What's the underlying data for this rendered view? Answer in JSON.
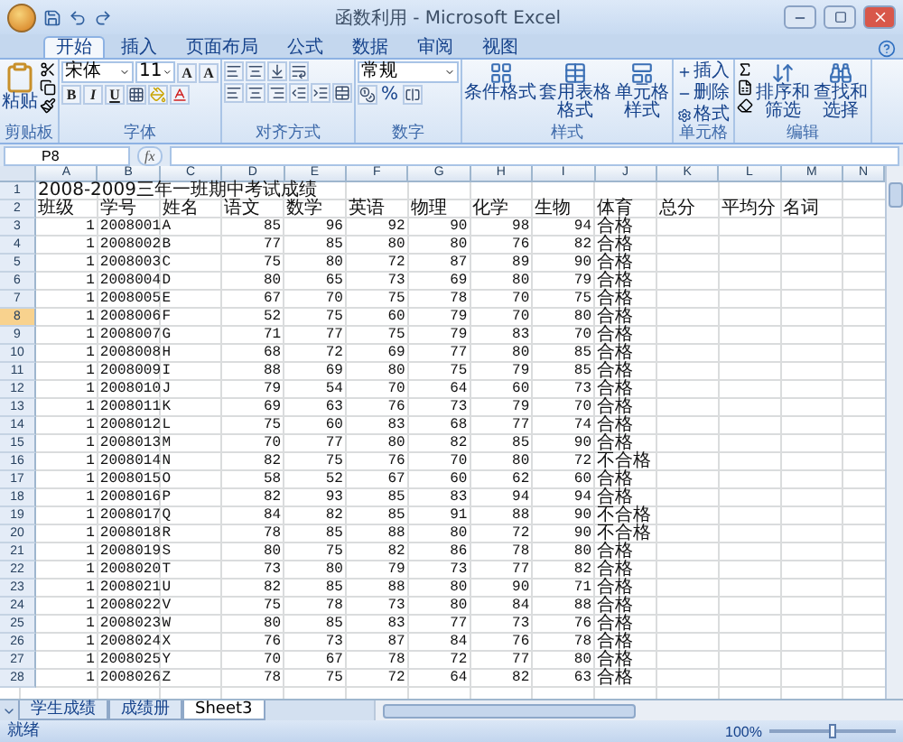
{
  "window": {
    "title": "函数利用 - Microsoft Excel"
  },
  "ribbon_tabs": [
    {
      "label": "开始",
      "selected": true
    },
    {
      "label": "插入",
      "selected": false
    },
    {
      "label": "页面布局",
      "selected": false
    },
    {
      "label": "公式",
      "selected": false
    },
    {
      "label": "数据",
      "selected": false
    },
    {
      "label": "审阅",
      "selected": false
    },
    {
      "label": "视图",
      "selected": false
    }
  ],
  "clipboard": {
    "label": "剪贴板",
    "paste": "粘贴"
  },
  "font": {
    "label": "字体",
    "name": "宋体",
    "size": "11",
    "grow_shrink": [
      "A",
      "A"
    ],
    "styles": [
      "B",
      "I",
      "U"
    ]
  },
  "alignment": {
    "label": "对齐方式"
  },
  "number": {
    "label": "数字",
    "format": "常规",
    "percent": "%"
  },
  "styles": {
    "label": "样式",
    "buttons": [
      "条件格式",
      "套用表格格式",
      "单元格样式"
    ]
  },
  "cells": {
    "label": "单元格",
    "buttons": [
      "插入",
      "删除",
      "格式"
    ]
  },
  "editing": {
    "label": "编辑",
    "buttons": [
      "排序和筛选",
      "查找和选择"
    ]
  },
  "formula_bar": {
    "name_box": "P8",
    "function_label": "fx"
  },
  "columns": [
    "A",
    "B",
    "C",
    "D",
    "E",
    "F",
    "G",
    "H",
    "I",
    "J",
    "K",
    "L",
    "M",
    "N"
  ],
  "rows": [
    {
      "number": "1",
      "kind": "title",
      "selected": false,
      "cells": [
        "2008-2009三年一班期中考试成绩"
      ]
    },
    {
      "number": "2",
      "kind": "header",
      "selected": false,
      "cells": [
        "班级",
        "学号",
        "姓名",
        "语文",
        "数学",
        "英语",
        "物理",
        "化学",
        "生物",
        "体育",
        "总分",
        "平均分",
        "名词"
      ]
    },
    {
      "number": "3",
      "kind": "data",
      "selected": false,
      "cells": [
        "1",
        "2008001",
        "A",
        "85",
        "96",
        "92",
        "90",
        "98",
        "94",
        "合格"
      ]
    },
    {
      "number": "4",
      "kind": "data",
      "selected": false,
      "cells": [
        "1",
        "2008002",
        "B",
        "77",
        "85",
        "80",
        "80",
        "76",
        "82",
        "合格"
      ]
    },
    {
      "number": "5",
      "kind": "data",
      "selected": false,
      "cells": [
        "1",
        "2008003",
        "C",
        "75",
        "80",
        "72",
        "87",
        "89",
        "90",
        "合格"
      ]
    },
    {
      "number": "6",
      "kind": "data",
      "selected": false,
      "cells": [
        "1",
        "2008004",
        "D",
        "80",
        "65",
        "73",
        "69",
        "80",
        "79",
        "合格"
      ]
    },
    {
      "number": "7",
      "kind": "data",
      "selected": false,
      "cells": [
        "1",
        "2008005",
        "E",
        "67",
        "70",
        "75",
        "78",
        "70",
        "75",
        "合格"
      ]
    },
    {
      "number": "8",
      "kind": "data",
      "selected": true,
      "cells": [
        "1",
        "2008006",
        "F",
        "52",
        "75",
        "60",
        "79",
        "70",
        "80",
        "合格"
      ]
    },
    {
      "number": "9",
      "kind": "data",
      "selected": false,
      "cells": [
        "1",
        "2008007",
        "G",
        "71",
        "77",
        "75",
        "79",
        "83",
        "70",
        "合格"
      ]
    },
    {
      "number": "10",
      "kind": "data",
      "selected": false,
      "cells": [
        "1",
        "2008008",
        "H",
        "68",
        "72",
        "69",
        "77",
        "80",
        "85",
        "合格"
      ]
    },
    {
      "number": "11",
      "kind": "data",
      "selected": false,
      "cells": [
        "1",
        "2008009",
        "I",
        "88",
        "69",
        "80",
        "75",
        "79",
        "85",
        "合格"
      ]
    },
    {
      "number": "12",
      "kind": "data",
      "selected": false,
      "cells": [
        "1",
        "2008010",
        "J",
        "79",
        "54",
        "70",
        "64",
        "60",
        "73",
        "合格"
      ]
    },
    {
      "number": "13",
      "kind": "data",
      "selected": false,
      "cells": [
        "1",
        "2008011",
        "K",
        "69",
        "63",
        "76",
        "73",
        "79",
        "70",
        "合格"
      ]
    },
    {
      "number": "14",
      "kind": "data",
      "selected": false,
      "cells": [
        "1",
        "2008012",
        "L",
        "75",
        "60",
        "83",
        "68",
        "77",
        "74",
        "合格"
      ]
    },
    {
      "number": "15",
      "kind": "data",
      "selected": false,
      "cells": [
        "1",
        "2008013",
        "M",
        "70",
        "77",
        "80",
        "82",
        "85",
        "90",
        "合格"
      ]
    },
    {
      "number": "16",
      "kind": "data",
      "selected": false,
      "cells": [
        "1",
        "2008014",
        "N",
        "82",
        "75",
        "76",
        "70",
        "80",
        "72",
        "不合格"
      ]
    },
    {
      "number": "17",
      "kind": "data",
      "selected": false,
      "cells": [
        "1",
        "2008015",
        "O",
        "58",
        "52",
        "67",
        "60",
        "62",
        "60",
        "合格"
      ]
    },
    {
      "number": "18",
      "kind": "data",
      "selected": false,
      "cells": [
        "1",
        "2008016",
        "P",
        "82",
        "93",
        "85",
        "83",
        "94",
        "94",
        "合格"
      ]
    },
    {
      "number": "19",
      "kind": "data",
      "selected": false,
      "cells": [
        "1",
        "2008017",
        "Q",
        "84",
        "82",
        "85",
        "91",
        "88",
        "90",
        "不合格"
      ]
    },
    {
      "number": "20",
      "kind": "data",
      "selected": false,
      "cells": [
        "1",
        "2008018",
        "R",
        "78",
        "85",
        "88",
        "80",
        "72",
        "90",
        "不合格"
      ]
    },
    {
      "number": "21",
      "kind": "data",
      "selected": false,
      "cells": [
        "1",
        "2008019",
        "S",
        "80",
        "75",
        "82",
        "86",
        "78",
        "80",
        "合格"
      ]
    },
    {
      "number": "22",
      "kind": "data",
      "selected": false,
      "cells": [
        "1",
        "2008020",
        "T",
        "73",
        "80",
        "79",
        "73",
        "77",
        "82",
        "合格"
      ]
    },
    {
      "number": "23",
      "kind": "data",
      "selected": false,
      "cells": [
        "1",
        "2008021",
        "U",
        "82",
        "85",
        "88",
        "80",
        "90",
        "71",
        "合格"
      ]
    },
    {
      "number": "24",
      "kind": "data",
      "selected": false,
      "cells": [
        "1",
        "2008022",
        "V",
        "75",
        "78",
        "73",
        "80",
        "84",
        "88",
        "合格"
      ]
    },
    {
      "number": "25",
      "kind": "data",
      "selected": false,
      "cells": [
        "1",
        "2008023",
        "W",
        "80",
        "85",
        "83",
        "77",
        "73",
        "76",
        "合格"
      ]
    },
    {
      "number": "26",
      "kind": "data",
      "selected": false,
      "cells": [
        "1",
        "2008024",
        "X",
        "76",
        "73",
        "87",
        "84",
        "76",
        "78",
        "合格"
      ]
    },
    {
      "number": "27",
      "kind": "data",
      "selected": false,
      "cells": [
        "1",
        "2008025",
        "Y",
        "70",
        "67",
        "78",
        "72",
        "77",
        "80",
        "合格"
      ]
    },
    {
      "number": "28",
      "kind": "data",
      "selected": false,
      "cells": [
        "1",
        "2008026",
        "Z",
        "78",
        "75",
        "72",
        "64",
        "82",
        "63",
        "合格"
      ]
    }
  ],
  "sheet_tabs": [
    {
      "label": "学生成绩",
      "selected": false
    },
    {
      "label": "成绩册",
      "selected": false
    },
    {
      "label": "Sheet3",
      "selected": true
    }
  ],
  "status_bar": {
    "status": "就绪",
    "zoom": "100%",
    "zoom_level": {
      "level": 0.5
    }
  }
}
